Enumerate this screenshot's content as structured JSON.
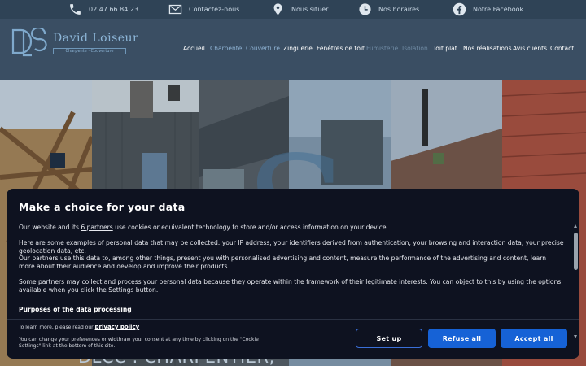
{
  "topbar": {
    "phone": {
      "text": "02 47 66 84 23",
      "icon": "phone-icon"
    },
    "contact": {
      "text": "Contactez-nous",
      "icon": "envelope-icon"
    },
    "location": {
      "text": "Nous situer",
      "icon": "map-pin-icon"
    },
    "hours": {
      "text": "Nos horaires",
      "icon": "clock-icon"
    },
    "facebook": {
      "text": "Notre Facebook",
      "icon": "facebook-icon"
    }
  },
  "logo": {
    "monogram": "DLC",
    "name": "David Loiseur",
    "tagline": "Charpente · Couverture"
  },
  "nav": [
    {
      "label": "Accueil",
      "color": "#ffffff"
    },
    {
      "label": "Charpente",
      "color": "#8fb3d4"
    },
    {
      "label": "Couverture",
      "color": "#8fb3d4"
    },
    {
      "label": "Zinguerie",
      "color": "#ffffff"
    },
    {
      "label": "Fenêtres de toit",
      "color": "#ffffff"
    },
    {
      "label": "Fumisterie",
      "color": "#6f8aa3"
    },
    {
      "label": "Isolation",
      "color": "#6f8aa3"
    },
    {
      "label": "Toit plat",
      "color": "#ffffff"
    },
    {
      "label": "Nos réalisations",
      "color": "#ffffff"
    },
    {
      "label": "Avis clients",
      "color": "#ffffff"
    },
    {
      "label": "Contact",
      "color": "#ffffff"
    }
  ],
  "hero": {
    "title": "DLCC : CHARPENTIER,"
  },
  "consent": {
    "title": "Make a choice for your data",
    "intro_before": "Our website and its ",
    "intro_link": "6 partners",
    "intro_after": " use cookies or equivalent technology to store and/or access information on your device.",
    "para2": "Here are some examples of personal data that may be collected: your IP address, your identifiers derived from authentication, your browsing and interaction data, your precise geolocation data, etc.",
    "para3": "Our partners use this data to, among other things, present you with personalised advertising and content, measure the performance of the advertising and content, learn more about their audience and develop and improve their products.",
    "para4": "Some partners may collect and process your personal data because they operate within the framework of their legitimate interests. You can object to this by using the options available when you click the Settings button.",
    "purposes": "Purposes of the data processing",
    "learn_more": "To learn more, please read our ",
    "privacy_link": "privacy policy",
    "change_text": "You can change your preferences or widthraw your consent at any time by clicking on the \"Cookie Settings\" link at the bottom of this site.",
    "btn_setup": "Set up",
    "btn_refuse": "Refuse all",
    "btn_accept": "Accept all",
    "accent": "#1662d6"
  }
}
